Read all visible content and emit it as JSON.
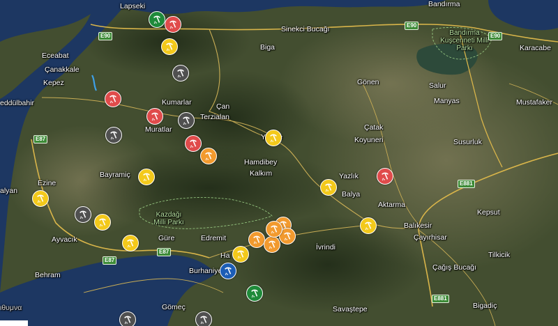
{
  "map": {
    "colors": {
      "sea": "#1d3762",
      "land": "#3f4b2e",
      "red": "#e04b4b",
      "yellow": "#f3c91b",
      "orange": "#f29a2e",
      "green": "#1f8a3a",
      "grey": "#505050",
      "blue": "#1c5db5"
    },
    "places": [
      {
        "name": "Lapseki"
      },
      {
        "name": "Bandırma"
      },
      {
        "name": "Sinekci Bucağı"
      },
      {
        "name": "Biga"
      },
      {
        "name": "Eceabat"
      },
      {
        "name": "Çanakkale"
      },
      {
        "name": "Kepez"
      },
      {
        "name": "eddülbahir"
      },
      {
        "name": "Kumarlar"
      },
      {
        "name": "Çan"
      },
      {
        "name": "Gönen"
      },
      {
        "name": "Salur"
      },
      {
        "name": "Manyas"
      },
      {
        "name": "Mustafaker"
      },
      {
        "name": "Karacabe"
      },
      {
        "name": "Terzialan"
      },
      {
        "name": "Muratlar"
      },
      {
        "name": "Yenice"
      },
      {
        "name": "Çatak"
      },
      {
        "name": "Koyuneri"
      },
      {
        "name": "Susurluk"
      },
      {
        "name": "Hamdibey"
      },
      {
        "name": "Kalkım"
      },
      {
        "name": "Bayramiç"
      },
      {
        "name": "Yazlık"
      },
      {
        "name": "Balya"
      },
      {
        "name": "Ezine"
      },
      {
        "name": "alyan"
      },
      {
        "name": "Aktarma"
      },
      {
        "name": "Kepsut"
      },
      {
        "name": "Balıkesir"
      },
      {
        "name": "Çayırhisar"
      },
      {
        "name": "Ayvacık"
      },
      {
        "name": "Güre"
      },
      {
        "name": "Edremit"
      },
      {
        "name": "İvrindi"
      },
      {
        "name": "Tilkicik"
      },
      {
        "name": "Ha"
      },
      {
        "name": "Burhaniye"
      },
      {
        "name": "Behram"
      },
      {
        "name": "Çağış Bucağı"
      },
      {
        "name": "Gömeç"
      },
      {
        "name": "Savaştepe"
      },
      {
        "name": "Bigadiç"
      },
      {
        "name": "ιθυμνα"
      }
    ],
    "parks": [
      {
        "name": "Bandırma Kuşcenneti Milli Parkı"
      },
      {
        "name": "Kazdağı Milli Parkı"
      }
    ],
    "shields": [
      "E90",
      "E90",
      "E90",
      "E87",
      "E87",
      "E87",
      "E881",
      "E881"
    ],
    "markers": [
      {
        "color": "green",
        "icon": "mining-pick-icon"
      },
      {
        "color": "red",
        "icon": "mining-pick-icon"
      },
      {
        "color": "yellow",
        "icon": "mining-pick-icon"
      },
      {
        "color": "grey",
        "icon": "mining-pick-icon"
      },
      {
        "color": "red",
        "icon": "mining-pick-icon"
      },
      {
        "color": "red",
        "icon": "mining-pick-icon"
      },
      {
        "color": "grey",
        "icon": "mining-pick-icon"
      },
      {
        "color": "grey",
        "icon": "mining-pick-icon"
      },
      {
        "color": "red",
        "icon": "mining-pick-icon"
      },
      {
        "color": "orange",
        "icon": "mining-pick-icon"
      },
      {
        "color": "yellow",
        "icon": "mining-pick-icon"
      },
      {
        "color": "yellow",
        "icon": "mining-pick-icon"
      },
      {
        "color": "yellow",
        "icon": "mining-pick-icon"
      },
      {
        "color": "red",
        "icon": "mining-pick-icon"
      },
      {
        "color": "yellow",
        "icon": "mining-pick-icon"
      },
      {
        "color": "grey",
        "icon": "mining-pick-icon"
      },
      {
        "color": "yellow",
        "icon": "mining-pick-icon"
      },
      {
        "color": "yellow",
        "icon": "mining-pick-icon"
      },
      {
        "color": "yellow",
        "icon": "mining-pick-icon"
      },
      {
        "color": "orange",
        "icon": "mining-pick-icon"
      },
      {
        "color": "orange",
        "icon": "mining-pick-icon"
      },
      {
        "color": "orange",
        "icon": "mining-pick-icon"
      },
      {
        "color": "orange",
        "icon": "mining-pick-icon"
      },
      {
        "color": "orange",
        "icon": "mining-pick-icon"
      },
      {
        "color": "yellow",
        "icon": "mining-pick-icon"
      },
      {
        "color": "blue",
        "icon": "mining-pick-icon"
      },
      {
        "color": "green",
        "icon": "mining-pick-icon"
      },
      {
        "color": "grey",
        "icon": "mining-pick-icon"
      },
      {
        "color": "grey",
        "icon": "mining-pick-icon"
      }
    ]
  }
}
